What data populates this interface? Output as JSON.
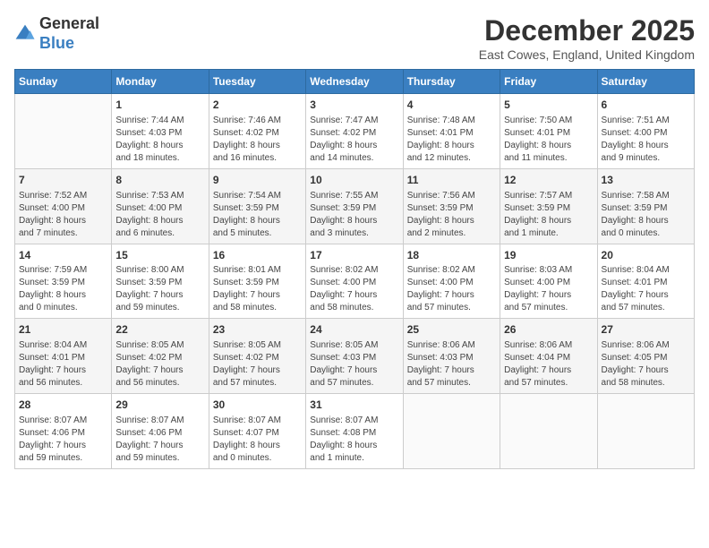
{
  "header": {
    "logo_line1": "General",
    "logo_line2": "Blue",
    "title": "December 2025",
    "subtitle": "East Cowes, England, United Kingdom"
  },
  "days_of_week": [
    "Sunday",
    "Monday",
    "Tuesday",
    "Wednesday",
    "Thursday",
    "Friday",
    "Saturday"
  ],
  "weeks": [
    [
      {
        "day": "",
        "info": ""
      },
      {
        "day": "1",
        "info": "Sunrise: 7:44 AM\nSunset: 4:03 PM\nDaylight: 8 hours\nand 18 minutes."
      },
      {
        "day": "2",
        "info": "Sunrise: 7:46 AM\nSunset: 4:02 PM\nDaylight: 8 hours\nand 16 minutes."
      },
      {
        "day": "3",
        "info": "Sunrise: 7:47 AM\nSunset: 4:02 PM\nDaylight: 8 hours\nand 14 minutes."
      },
      {
        "day": "4",
        "info": "Sunrise: 7:48 AM\nSunset: 4:01 PM\nDaylight: 8 hours\nand 12 minutes."
      },
      {
        "day": "5",
        "info": "Sunrise: 7:50 AM\nSunset: 4:01 PM\nDaylight: 8 hours\nand 11 minutes."
      },
      {
        "day": "6",
        "info": "Sunrise: 7:51 AM\nSunset: 4:00 PM\nDaylight: 8 hours\nand 9 minutes."
      }
    ],
    [
      {
        "day": "7",
        "info": "Sunrise: 7:52 AM\nSunset: 4:00 PM\nDaylight: 8 hours\nand 7 minutes."
      },
      {
        "day": "8",
        "info": "Sunrise: 7:53 AM\nSunset: 4:00 PM\nDaylight: 8 hours\nand 6 minutes."
      },
      {
        "day": "9",
        "info": "Sunrise: 7:54 AM\nSunset: 3:59 PM\nDaylight: 8 hours\nand 5 minutes."
      },
      {
        "day": "10",
        "info": "Sunrise: 7:55 AM\nSunset: 3:59 PM\nDaylight: 8 hours\nand 3 minutes."
      },
      {
        "day": "11",
        "info": "Sunrise: 7:56 AM\nSunset: 3:59 PM\nDaylight: 8 hours\nand 2 minutes."
      },
      {
        "day": "12",
        "info": "Sunrise: 7:57 AM\nSunset: 3:59 PM\nDaylight: 8 hours\nand 1 minute."
      },
      {
        "day": "13",
        "info": "Sunrise: 7:58 AM\nSunset: 3:59 PM\nDaylight: 8 hours\nand 0 minutes."
      }
    ],
    [
      {
        "day": "14",
        "info": "Sunrise: 7:59 AM\nSunset: 3:59 PM\nDaylight: 8 hours\nand 0 minutes."
      },
      {
        "day": "15",
        "info": "Sunrise: 8:00 AM\nSunset: 3:59 PM\nDaylight: 7 hours\nand 59 minutes."
      },
      {
        "day": "16",
        "info": "Sunrise: 8:01 AM\nSunset: 3:59 PM\nDaylight: 7 hours\nand 58 minutes."
      },
      {
        "day": "17",
        "info": "Sunrise: 8:02 AM\nSunset: 4:00 PM\nDaylight: 7 hours\nand 58 minutes."
      },
      {
        "day": "18",
        "info": "Sunrise: 8:02 AM\nSunset: 4:00 PM\nDaylight: 7 hours\nand 57 minutes."
      },
      {
        "day": "19",
        "info": "Sunrise: 8:03 AM\nSunset: 4:00 PM\nDaylight: 7 hours\nand 57 minutes."
      },
      {
        "day": "20",
        "info": "Sunrise: 8:04 AM\nSunset: 4:01 PM\nDaylight: 7 hours\nand 57 minutes."
      }
    ],
    [
      {
        "day": "21",
        "info": "Sunrise: 8:04 AM\nSunset: 4:01 PM\nDaylight: 7 hours\nand 56 minutes."
      },
      {
        "day": "22",
        "info": "Sunrise: 8:05 AM\nSunset: 4:02 PM\nDaylight: 7 hours\nand 56 minutes."
      },
      {
        "day": "23",
        "info": "Sunrise: 8:05 AM\nSunset: 4:02 PM\nDaylight: 7 hours\nand 57 minutes."
      },
      {
        "day": "24",
        "info": "Sunrise: 8:05 AM\nSunset: 4:03 PM\nDaylight: 7 hours\nand 57 minutes."
      },
      {
        "day": "25",
        "info": "Sunrise: 8:06 AM\nSunset: 4:03 PM\nDaylight: 7 hours\nand 57 minutes."
      },
      {
        "day": "26",
        "info": "Sunrise: 8:06 AM\nSunset: 4:04 PM\nDaylight: 7 hours\nand 57 minutes."
      },
      {
        "day": "27",
        "info": "Sunrise: 8:06 AM\nSunset: 4:05 PM\nDaylight: 7 hours\nand 58 minutes."
      }
    ],
    [
      {
        "day": "28",
        "info": "Sunrise: 8:07 AM\nSunset: 4:06 PM\nDaylight: 7 hours\nand 59 minutes."
      },
      {
        "day": "29",
        "info": "Sunrise: 8:07 AM\nSunset: 4:06 PM\nDaylight: 7 hours\nand 59 minutes."
      },
      {
        "day": "30",
        "info": "Sunrise: 8:07 AM\nSunset: 4:07 PM\nDaylight: 8 hours\nand 0 minutes."
      },
      {
        "day": "31",
        "info": "Sunrise: 8:07 AM\nSunset: 4:08 PM\nDaylight: 8 hours\nand 1 minute."
      },
      {
        "day": "",
        "info": ""
      },
      {
        "day": "",
        "info": ""
      },
      {
        "day": "",
        "info": ""
      }
    ]
  ]
}
